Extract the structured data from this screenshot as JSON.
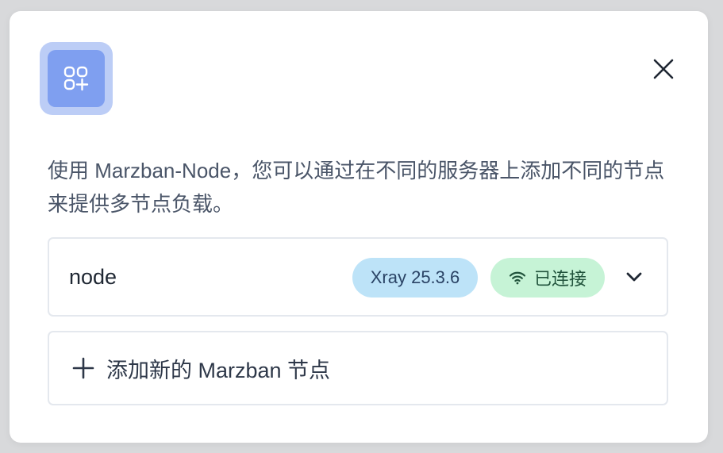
{
  "dialog": {
    "description": "使用 Marzban-Node，您可以通过在不同的服务器上添加不同的节点来提供多节点负载。",
    "icon": "apps-add-icon",
    "close_icon": "close-icon"
  },
  "nodes": [
    {
      "name": "node",
      "xray_badge": "Xray 25.3.6",
      "status_icon": "wifi-icon",
      "status_label": "已连接",
      "expand_icon": "chevron-down-icon"
    }
  ],
  "add_node": {
    "icon": "plus-icon",
    "label": "添加新的 Marzban 节点"
  },
  "colors": {
    "icon_bg_outer": "#bccdf6",
    "icon_bg_inner": "#7f9ff0",
    "xray_badge_bg": "#bde3f8",
    "status_badge_bg": "#c6f3d6",
    "status_text": "#22543d"
  }
}
